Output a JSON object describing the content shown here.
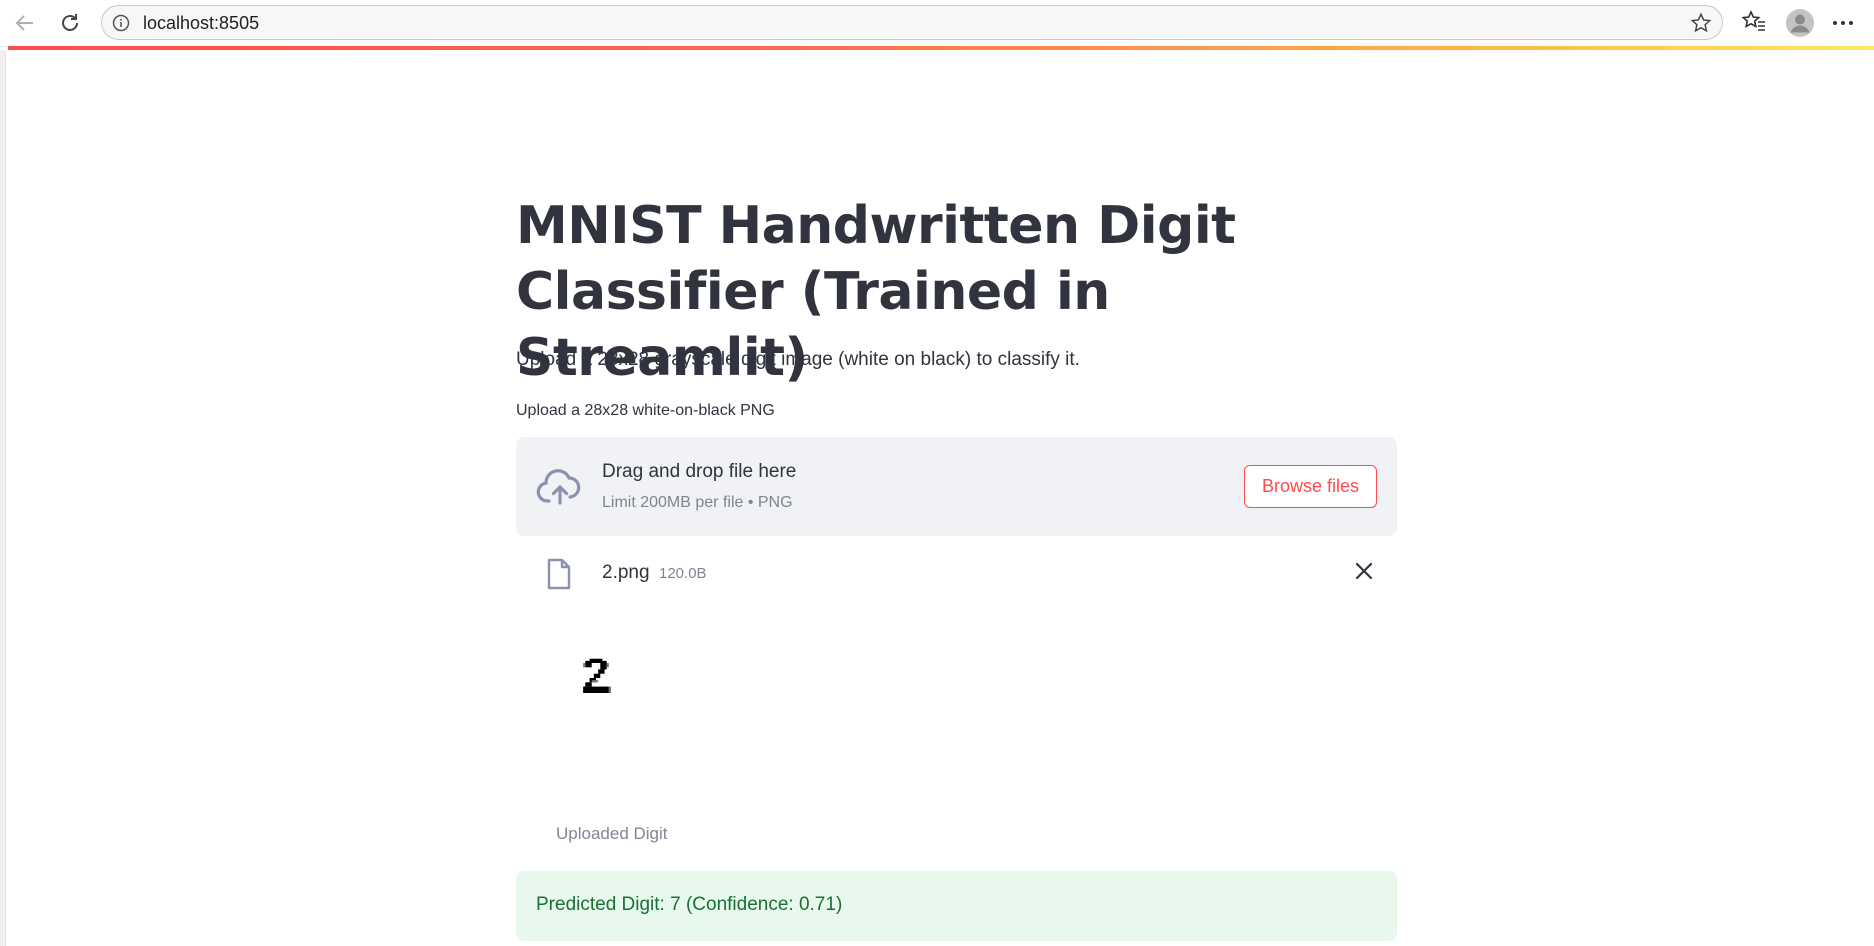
{
  "browser": {
    "url": "localhost:8505",
    "icons": [
      "back-arrow-icon",
      "reload-icon",
      "info-icon",
      "star-icon",
      "favorites-icon",
      "profile-avatar-icon",
      "more-menu-icon"
    ]
  },
  "app": {
    "title": "MNIST Handwritten Digit Classifier (Trained in Streamlit)",
    "subtitle": "Upload a 28x28 grayscale digit image (white on black) to classify it.",
    "uploader": {
      "label": "Upload a 28x28 white-on-black PNG",
      "drop_title": "Drag and drop file here",
      "drop_limit": "Limit 200MB per file • PNG",
      "browse_label": "Browse files"
    },
    "file": {
      "name": "2.png",
      "size": "120.0B"
    },
    "image": {
      "depicted_digit": "2",
      "caption": "Uploaded Digit"
    },
    "result": {
      "text": "Predicted Digit: 7 (Confidence: 0.71)"
    }
  },
  "colors": {
    "accent": "#ff4b4b",
    "text": "#31333f",
    "muted": "#808495",
    "dropzone_bg": "#f0f2f6",
    "success_bg": "#e8f8ec",
    "success_text": "#177233"
  }
}
